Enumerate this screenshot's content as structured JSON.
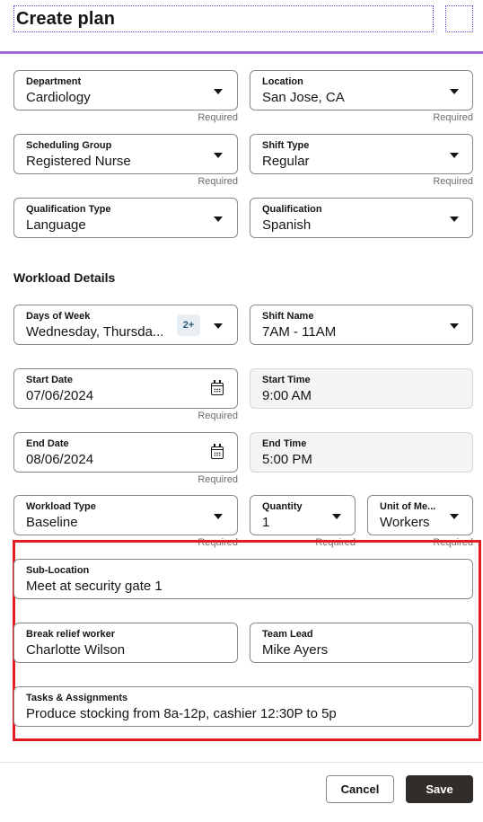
{
  "header": {
    "title": "Create  plan"
  },
  "fields": {
    "department": {
      "label": "Department",
      "value": "Cardiology",
      "helper": "Required"
    },
    "location": {
      "label": "Location",
      "value": "San Jose, CA",
      "helper": "Required"
    },
    "scheduling_group": {
      "label": "Scheduling Group",
      "value": "Registered Nurse",
      "helper": "Required"
    },
    "shift_type": {
      "label": "Shift Type",
      "value": "Regular",
      "helper": "Required"
    },
    "qualification_type": {
      "label": "Qualification Type",
      "value": "Language"
    },
    "qualification": {
      "label": "Qualification",
      "value": "Spanish"
    }
  },
  "workload": {
    "section_title": "Workload Details",
    "days_of_week": {
      "label": "Days of Week",
      "value": "Wednesday, Thursda...",
      "badge": "2+"
    },
    "shift_name": {
      "label": "Shift Name",
      "value": "7AM - 11AM"
    },
    "start_date": {
      "label": "Start Date",
      "value": "07/06/2024",
      "helper": "Required"
    },
    "start_time": {
      "label": "Start Time",
      "value": "9:00 AM"
    },
    "end_date": {
      "label": "End Date",
      "value": "08/06/2024",
      "helper": "Required"
    },
    "end_time": {
      "label": "End Time",
      "value": "5:00 PM"
    },
    "workload_type": {
      "label": "Workload Type",
      "value": "Baseline",
      "helper": "Required"
    },
    "quantity": {
      "label": "Quantity",
      "value": "1",
      "helper": "Required"
    },
    "unit_of_measure": {
      "label": "Unit of Me...",
      "value": "Workers",
      "helper": "Required"
    }
  },
  "extra": {
    "sub_location": {
      "label": "Sub-Location",
      "value": "Meet at security gate 1"
    },
    "break_relief_worker": {
      "label": "Break relief worker",
      "value": "Charlotte Wilson"
    },
    "team_lead": {
      "label": "Team Lead",
      "value": "Mike Ayers"
    },
    "tasks": {
      "label": "Tasks & Assignments",
      "value": "Produce stocking from 8a-12p, cashier 12:30P to 5p"
    }
  },
  "footer": {
    "cancel_label": "Cancel",
    "save_label": "Save"
  },
  "colors": {
    "accent_line": "#9b6bd9",
    "highlight": "#e31b23",
    "primary_button": "#312d2a"
  }
}
